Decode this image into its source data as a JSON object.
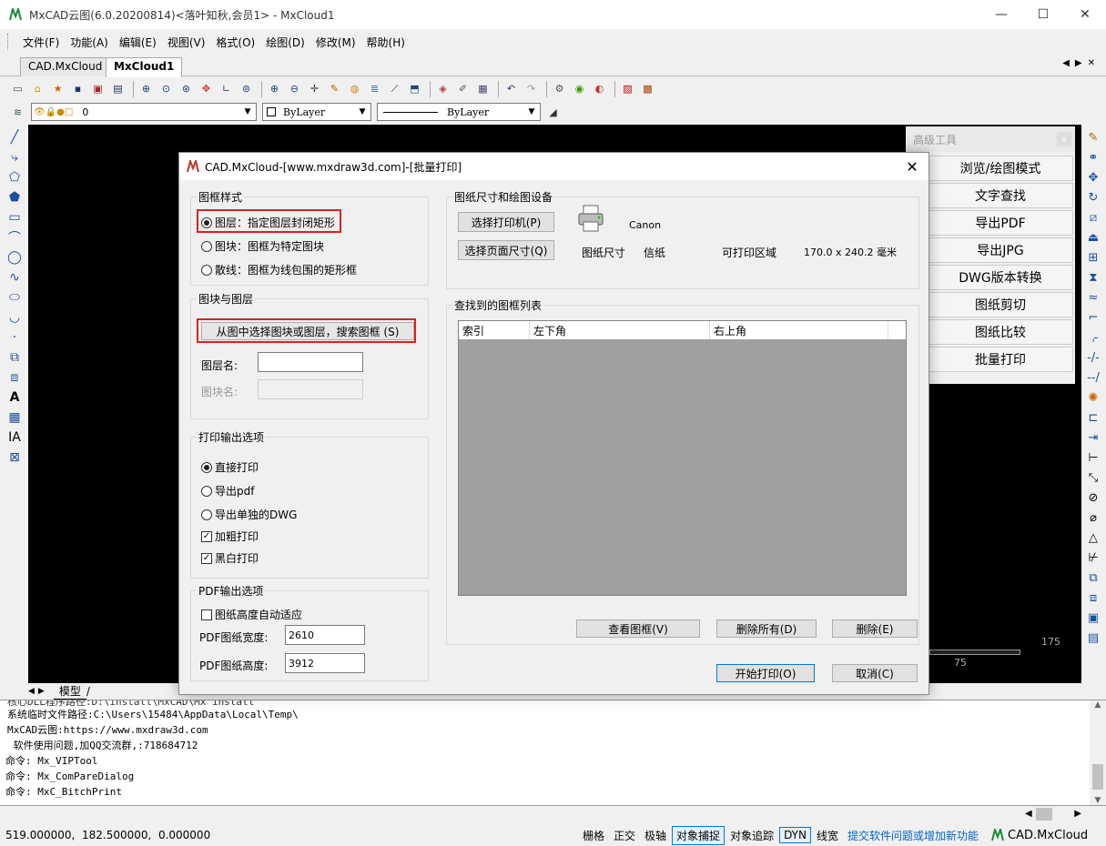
{
  "window": {
    "title": "MxCAD云图(6.0.20200814)<落叶知秋,会员1> - MxCloud1",
    "minimize": "—",
    "maximize": "☐",
    "close": "✕"
  },
  "menu": [
    "文件(F)",
    "功能(A)",
    "编辑(E)",
    "视图(V)",
    "格式(O)",
    "绘图(D)",
    "修改(M)",
    "帮助(H)"
  ],
  "doc_tabs": [
    {
      "label": "CAD.MxCloud",
      "active": false
    },
    {
      "label": "MxCloud1",
      "active": true
    }
  ],
  "layer_toolbar": {
    "layer_value": "0",
    "color_value": "ByLayer",
    "linetype_value": "ByLayer"
  },
  "advanced_panel": {
    "title": "高级工具",
    "close": "x",
    "buttons": [
      "浏览/绘图模式",
      "文字查找",
      "导出PDF",
      "导出JPG",
      "DWG版本转换",
      "图纸剪切",
      "图纸比较",
      "批量打印"
    ]
  },
  "canvas": {
    "ruler_label_a": "175",
    "ruler_label_b": "75"
  },
  "dialog": {
    "title": "CAD.MxCloud-[www.mxdraw3d.com]-[批量打印]",
    "close": "✕",
    "frame_style": {
      "legend": "图框样式",
      "options": [
        {
          "label": "图层：指定图层封闭矩形",
          "selected": true
        },
        {
          "label": "图块：图框为特定图块",
          "selected": false
        },
        {
          "label": "散线：图框为线包围的矩形框",
          "selected": false
        }
      ]
    },
    "block_layer": {
      "legend": "图块与图层",
      "select_button": "从图中选择图块或图层，搜索图框 (S)",
      "layer_name_label": "图层名:",
      "layer_name_value": "",
      "block_name_label": "图块名:",
      "block_name_value": ""
    },
    "print_output": {
      "legend": "打印输出选项",
      "options": [
        {
          "label": "直接打印",
          "selected": true
        },
        {
          "label": "导出pdf",
          "selected": false
        },
        {
          "label": "导出单独的DWG",
          "selected": false
        }
      ],
      "checks": [
        {
          "label": "加粗打印",
          "checked": true
        },
        {
          "label": "黑白打印",
          "checked": true
        }
      ]
    },
    "pdf_output": {
      "legend": "PDF输出选项",
      "auto_height_label": "图纸高度自动适应",
      "auto_height_checked": false,
      "width_label": "PDF图纸宽度:",
      "width_value": "2610",
      "height_label": "PDF图纸高度:",
      "height_value": "3912"
    },
    "paper_device": {
      "legend": "图纸尺寸和绘图设备",
      "select_printer": "选择打印机(P)",
      "select_page": "选择页面尺寸(Q)",
      "printer_name": "Canon",
      "paper_size_label": "图纸尺寸",
      "paper_size_value": "信纸",
      "printable_label": "可打印区域",
      "printable_value": "170.0 x 240.2 毫米"
    },
    "frame_list": {
      "legend": "查找到的图框列表",
      "columns": [
        "索引",
        "左下角",
        "右上角"
      ],
      "rows": []
    },
    "buttons": {
      "view_frame": "查看图框(V)",
      "delete_all": "删除所有(D)",
      "delete": "删除(E)",
      "start_print": "开始打印(O)",
      "cancel": "取消(C)"
    }
  },
  "model_tab": "模型",
  "command_lines": [
    "系统临时文件路径:C:\\Users\\15484\\AppData\\Local\\Temp\\",
    "MxCAD云图:https://www.mxdraw3d.com",
    " 软件使用问题,加QQ交流群,:718684712",
    "命令: Mx_VIPTool",
    "命令: Mx_ComPareDialog",
    "命令: MxC_BitchPrint"
  ],
  "command_partial": "核心DLL程序路径:D:\\install\\MxCAD\\Mx_install",
  "status": {
    "coords": "519.000000,  182.500000,  0.000000",
    "items": [
      {
        "label": "栅格",
        "on": false
      },
      {
        "label": "正交",
        "on": false
      },
      {
        "label": "极轴",
        "on": false
      },
      {
        "label": "对象捕捉",
        "on": true
      },
      {
        "label": "对象追踪",
        "on": false
      },
      {
        "label": "DYN",
        "on": true
      },
      {
        "label": "线宽",
        "on": false
      }
    ],
    "link": "提交软件问题或增加新功能",
    "brand": "CAD.MxCloud"
  },
  "colors": {
    "accent": "#0078d7",
    "highlight_box": "#e02020",
    "link": "#0066cc"
  }
}
